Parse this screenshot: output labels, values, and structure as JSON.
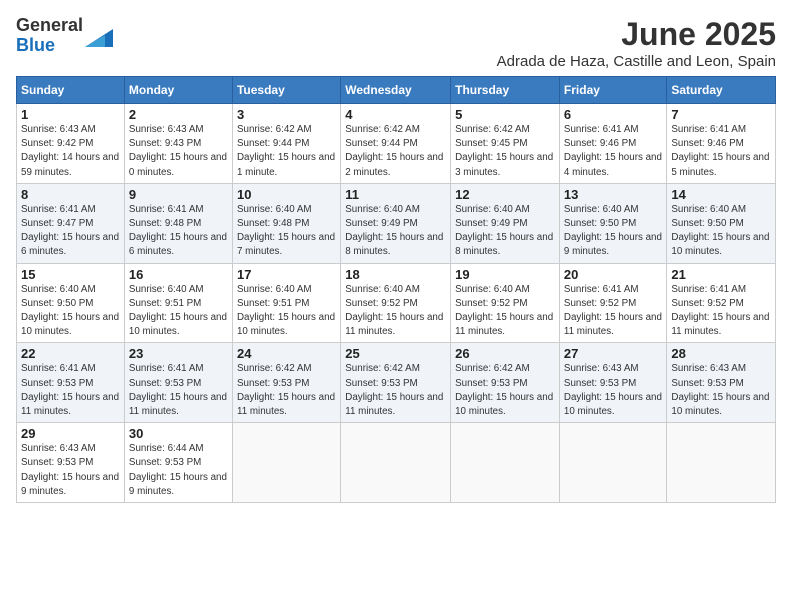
{
  "header": {
    "logo_general": "General",
    "logo_blue": "Blue",
    "month_title": "June 2025",
    "location": "Adrada de Haza, Castille and Leon, Spain"
  },
  "days_of_week": [
    "Sunday",
    "Monday",
    "Tuesday",
    "Wednesday",
    "Thursday",
    "Friday",
    "Saturday"
  ],
  "weeks": [
    [
      {
        "day": 1,
        "sunrise": "6:43 AM",
        "sunset": "9:42 PM",
        "daylight": "14 hours and 59 minutes."
      },
      {
        "day": 2,
        "sunrise": "6:43 AM",
        "sunset": "9:43 PM",
        "daylight": "15 hours and 0 minutes."
      },
      {
        "day": 3,
        "sunrise": "6:42 AM",
        "sunset": "9:44 PM",
        "daylight": "15 hours and 1 minute."
      },
      {
        "day": 4,
        "sunrise": "6:42 AM",
        "sunset": "9:44 PM",
        "daylight": "15 hours and 2 minutes."
      },
      {
        "day": 5,
        "sunrise": "6:42 AM",
        "sunset": "9:45 PM",
        "daylight": "15 hours and 3 minutes."
      },
      {
        "day": 6,
        "sunrise": "6:41 AM",
        "sunset": "9:46 PM",
        "daylight": "15 hours and 4 minutes."
      },
      {
        "day": 7,
        "sunrise": "6:41 AM",
        "sunset": "9:46 PM",
        "daylight": "15 hours and 5 minutes."
      }
    ],
    [
      {
        "day": 8,
        "sunrise": "6:41 AM",
        "sunset": "9:47 PM",
        "daylight": "15 hours and 6 minutes."
      },
      {
        "day": 9,
        "sunrise": "6:41 AM",
        "sunset": "9:48 PM",
        "daylight": "15 hours and 6 minutes."
      },
      {
        "day": 10,
        "sunrise": "6:40 AM",
        "sunset": "9:48 PM",
        "daylight": "15 hours and 7 minutes."
      },
      {
        "day": 11,
        "sunrise": "6:40 AM",
        "sunset": "9:49 PM",
        "daylight": "15 hours and 8 minutes."
      },
      {
        "day": 12,
        "sunrise": "6:40 AM",
        "sunset": "9:49 PM",
        "daylight": "15 hours and 8 minutes."
      },
      {
        "day": 13,
        "sunrise": "6:40 AM",
        "sunset": "9:50 PM",
        "daylight": "15 hours and 9 minutes."
      },
      {
        "day": 14,
        "sunrise": "6:40 AM",
        "sunset": "9:50 PM",
        "daylight": "15 hours and 10 minutes."
      }
    ],
    [
      {
        "day": 15,
        "sunrise": "6:40 AM",
        "sunset": "9:50 PM",
        "daylight": "15 hours and 10 minutes."
      },
      {
        "day": 16,
        "sunrise": "6:40 AM",
        "sunset": "9:51 PM",
        "daylight": "15 hours and 10 minutes."
      },
      {
        "day": 17,
        "sunrise": "6:40 AM",
        "sunset": "9:51 PM",
        "daylight": "15 hours and 10 minutes."
      },
      {
        "day": 18,
        "sunrise": "6:40 AM",
        "sunset": "9:52 PM",
        "daylight": "15 hours and 11 minutes."
      },
      {
        "day": 19,
        "sunrise": "6:40 AM",
        "sunset": "9:52 PM",
        "daylight": "15 hours and 11 minutes."
      },
      {
        "day": 20,
        "sunrise": "6:41 AM",
        "sunset": "9:52 PM",
        "daylight": "15 hours and 11 minutes."
      },
      {
        "day": 21,
        "sunrise": "6:41 AM",
        "sunset": "9:52 PM",
        "daylight": "15 hours and 11 minutes."
      }
    ],
    [
      {
        "day": 22,
        "sunrise": "6:41 AM",
        "sunset": "9:53 PM",
        "daylight": "15 hours and 11 minutes."
      },
      {
        "day": 23,
        "sunrise": "6:41 AM",
        "sunset": "9:53 PM",
        "daylight": "15 hours and 11 minutes."
      },
      {
        "day": 24,
        "sunrise": "6:42 AM",
        "sunset": "9:53 PM",
        "daylight": "15 hours and 11 minutes."
      },
      {
        "day": 25,
        "sunrise": "6:42 AM",
        "sunset": "9:53 PM",
        "daylight": "15 hours and 11 minutes."
      },
      {
        "day": 26,
        "sunrise": "6:42 AM",
        "sunset": "9:53 PM",
        "daylight": "15 hours and 10 minutes."
      },
      {
        "day": 27,
        "sunrise": "6:43 AM",
        "sunset": "9:53 PM",
        "daylight": "15 hours and 10 minutes."
      },
      {
        "day": 28,
        "sunrise": "6:43 AM",
        "sunset": "9:53 PM",
        "daylight": "15 hours and 10 minutes."
      }
    ],
    [
      {
        "day": 29,
        "sunrise": "6:43 AM",
        "sunset": "9:53 PM",
        "daylight": "15 hours and 9 minutes."
      },
      {
        "day": 30,
        "sunrise": "6:44 AM",
        "sunset": "9:53 PM",
        "daylight": "15 hours and 9 minutes."
      },
      null,
      null,
      null,
      null,
      null
    ]
  ]
}
